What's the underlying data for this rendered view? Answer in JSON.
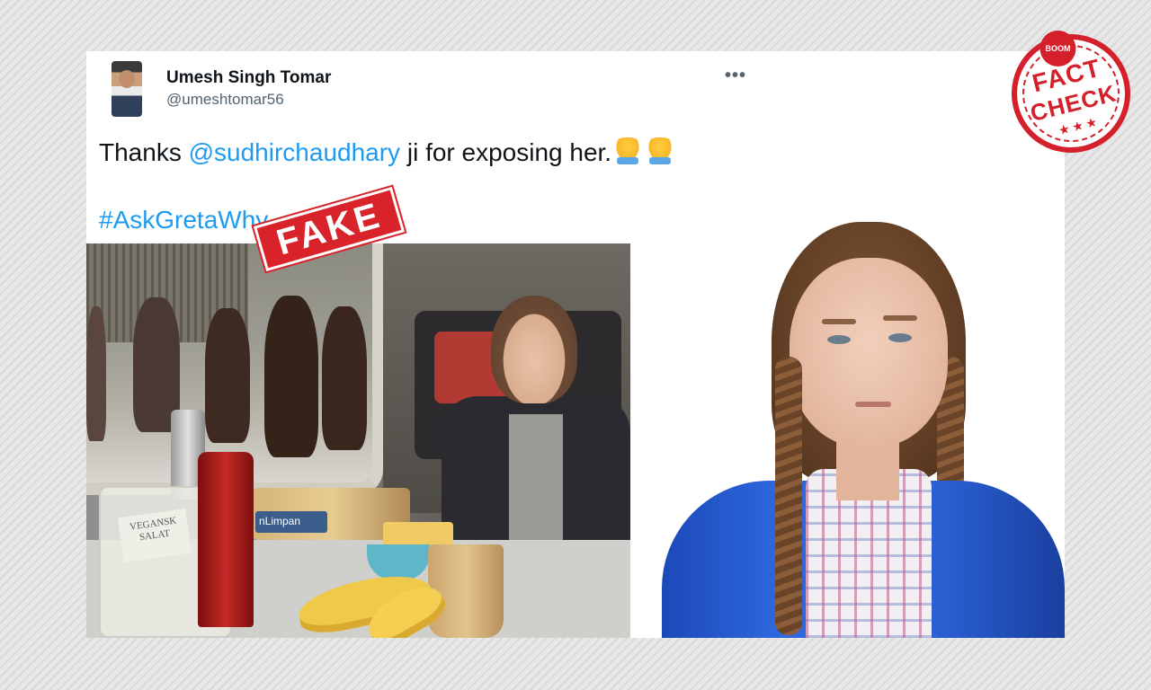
{
  "tweet": {
    "user_name": "Umesh Singh Tomar",
    "user_handle": "@umeshtomar56",
    "more_icon": "more-horizontal-icon",
    "more_glyph": "•••",
    "text_prefix": "Thanks ",
    "mention": "@sudhirchaudhary",
    "text_suffix": " ji for exposing her.",
    "emojis": [
      "folded-hands-emoji",
      "folded-hands-emoji"
    ],
    "hashtag": "#AskGretaWhy"
  },
  "images": {
    "left_stamp": "FAKE",
    "left_photo_label": "VEGANSK SALAT",
    "left_bread_label": "nLimpan"
  },
  "seal": {
    "brand": "BOOM",
    "line1": "FACT",
    "line2": "CHECK",
    "stars": "★★★"
  },
  "colors": {
    "link": "#1d9bf0",
    "stamp_red": "#d9232a",
    "seal_red": "#d4202b"
  }
}
